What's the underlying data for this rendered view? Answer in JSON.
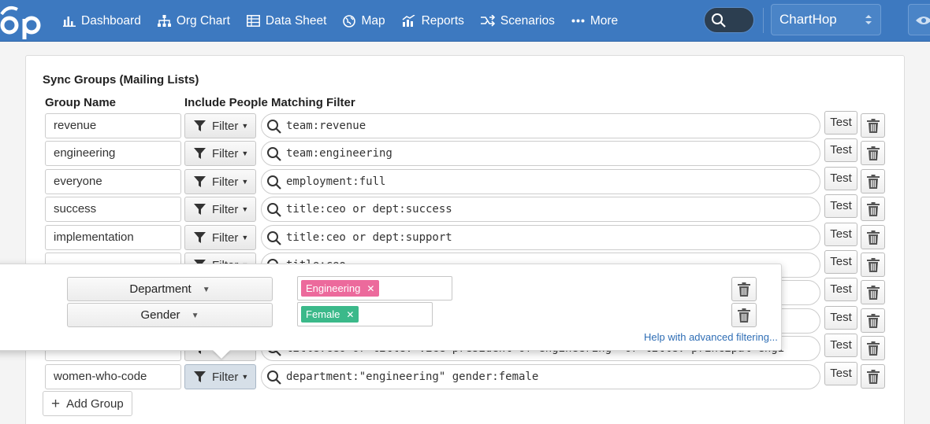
{
  "nav": {
    "items": [
      {
        "label": "Dashboard",
        "icon": "bar-chart-icon"
      },
      {
        "label": "Org Chart",
        "icon": "org-chart-icon"
      },
      {
        "label": "Data Sheet",
        "icon": "table-icon"
      },
      {
        "label": "Map",
        "icon": "globe-icon"
      },
      {
        "label": "Reports",
        "icon": "reports-icon"
      },
      {
        "label": "Scenarios",
        "icon": "scenarios-icon"
      },
      {
        "label": "More",
        "icon": "more-dots-icon"
      }
    ],
    "org_name": "ChartHop"
  },
  "panel": {
    "title": "Sync Groups (Mailing Lists)",
    "col_group_name": "Group Name",
    "col_filter": "Include People Matching Filter"
  },
  "rows": [
    {
      "name": "revenue",
      "filter_label": "Filter",
      "query": "team:revenue",
      "test_label": "Test"
    },
    {
      "name": "engineering",
      "filter_label": "Filter",
      "query": "team:engineering",
      "test_label": "Test"
    },
    {
      "name": "everyone",
      "filter_label": "Filter",
      "query": "employment:full",
      "test_label": "Test"
    },
    {
      "name": "success",
      "filter_label": "Filter",
      "query": "title:ceo or dept:success",
      "test_label": "Test"
    },
    {
      "name": "implementation",
      "filter_label": "Filter",
      "query": "title:ceo or dept:support",
      "test_label": "Test"
    },
    {
      "name": "",
      "filter_label": "Filter",
      "query": "title:ceo",
      "test_label": "Test"
    },
    {
      "name": "",
      "filter_label": "",
      "query": "",
      "test_label": "Test"
    },
    {
      "name": "",
      "filter_label": "",
      "query": "",
      "test_label": "Test"
    },
    {
      "name": "",
      "filter_label": "",
      "query": "title:ceo or title:\"vice president of engineering\" or title:\"principal engi",
      "test_label": "Test"
    },
    {
      "name": "women-who-code",
      "filter_label": "Filter",
      "query": "department:\"engineering\" gender:female",
      "test_label": "Test"
    }
  ],
  "add_group_label": "Add Group",
  "popover": {
    "conditions": [
      {
        "field": "Department",
        "tag": "Engineering",
        "tag_color": "#ec6a9c"
      },
      {
        "field": "Gender",
        "tag": "Female",
        "tag_color": "#3bb98a"
      }
    ],
    "help_link": "Help with advanced filtering..."
  },
  "colors": {
    "topbar": "#3d79c0",
    "link": "#2f6eb5"
  }
}
